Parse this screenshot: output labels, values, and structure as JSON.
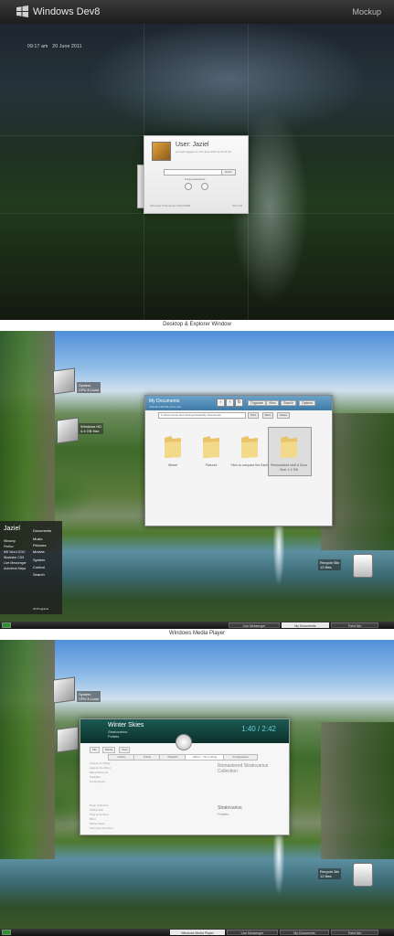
{
  "header": {
    "title": "Windows Dev8",
    "right_label": "Mockup"
  },
  "login": {
    "time": "09:17 am",
    "date": "20 June 2011",
    "user_name": "User: Jaziel",
    "user_subtitle": "you last logged on at 9 June 2011 at 10:47:44",
    "go_label": "Enter",
    "forgot_label": "Forgot password",
    "footer_left": "Windows 8 Developer Build 8095",
    "footer_right": "Shut Off"
  },
  "captions": {
    "explorer": "Desktop & Explorer Window",
    "media": "Windows Media Player"
  },
  "desktop": {
    "gadget_system": "System",
    "gadget_system_sub": "CPU 8 Load",
    "gadget_windows": "Windows HD",
    "gadget_windows_sub": "4.4 GB free",
    "recycle": "Recycle Bin",
    "recycle_sub": "12 files"
  },
  "explorer": {
    "title": "My Documents",
    "subtitle": "4 Items 1.02 Gb of 2.1 Gb",
    "address": "C:\\Documents and Settings\\Jaziel\\My Documents",
    "menu": [
      "Organize",
      "View",
      "Search",
      "Options"
    ],
    "buttons": [
      "Print",
      "Burn",
      "Share"
    ],
    "folders": [
      {
        "label": "Wheel"
      },
      {
        "label": "Pictures"
      },
      {
        "label": "Files to compare the Earth"
      },
      {
        "label": "Personalized stuff & Docs"
      }
    ],
    "selected_sub": "Size: 1.2 GB"
  },
  "start_menu": {
    "user": "Jaziel",
    "left_items": [
      "Winamp",
      "Firefox",
      "MS Word 2010",
      "Illustrator CS5",
      "Live Messenger",
      "Autodesk Maya"
    ],
    "right_items": [
      "Documents",
      "Music",
      "Pictures",
      "Movies",
      "System",
      "Control",
      "Search"
    ],
    "all_programs": "All Programs"
  },
  "taskbar1": [
    "Live Messenger",
    "My Documents",
    "Paint Mix"
  ],
  "taskbar2": [
    "Windows Media Player",
    "Live Messenger",
    "My Documents",
    "Paint Mix"
  ],
  "media_player": {
    "song": "Winter Skies",
    "artist": "Stratovarius",
    "album": "Polaris",
    "time": "1:40 / 2:42",
    "toolbar": [
      "File",
      "Media",
      "View"
    ],
    "tabs": [
      "Library",
      "Artists",
      "Playlists",
      "Album - Tiny Listing",
      "Configuration"
    ],
    "list": [
      "Deep Unknown",
      "Falling Star",
      "King of Nothing",
      "Blind",
      "Winter Skies",
      "Somehow Precious"
    ],
    "upper_list": [
      "Forever Is Today",
      "Against the Wind",
      "Black Diamond",
      "Paradise",
      "Dreamspace"
    ],
    "section_header": "Remastered Stratovarius Collection",
    "artist_header": "Stratovarius",
    "album_header": "Polaris"
  }
}
